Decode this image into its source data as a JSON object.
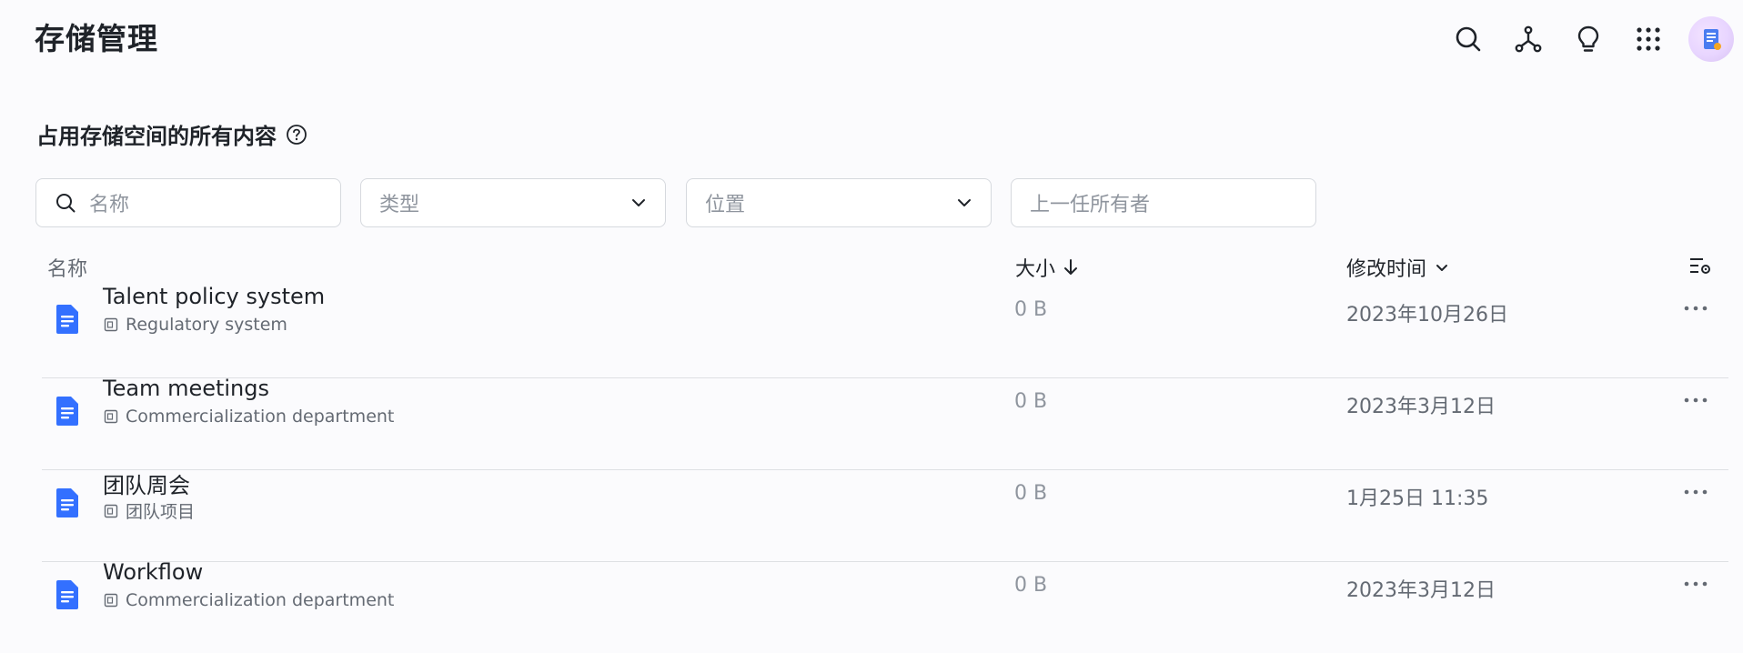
{
  "header": {
    "title": "存储管理"
  },
  "section": {
    "title": "占用存储空间的所有内容"
  },
  "filters": {
    "name_placeholder": "名称",
    "type_placeholder": "类型",
    "location_placeholder": "位置",
    "owner_placeholder": "上一任所有者"
  },
  "table": {
    "columns": {
      "name": "名称",
      "size": "大小",
      "modified": "修改时间"
    },
    "rows": [
      {
        "name": "Talent policy system",
        "location": "Regulatory system",
        "size": "0 B",
        "modified": "2023年10月26日"
      },
      {
        "name": "Team meetings",
        "location": "Commercialization department",
        "size": "0 B",
        "modified": "2023年3月12日"
      },
      {
        "name": "团队周会",
        "location": "团队项目",
        "size": "0 B",
        "modified": "1月25日 11:35"
      },
      {
        "name": "Workflow",
        "location": "Commercialization department",
        "size": "0 B",
        "modified": "2023年3月12日"
      }
    ]
  },
  "icons": {
    "top": [
      "search-icon",
      "org-graph-icon",
      "lightbulb-icon",
      "apps-grid-icon"
    ],
    "doc": "document-icon"
  },
  "colors": {
    "doc_icon": "#3370ff",
    "text": "#1f2329",
    "muted": "#646a73"
  }
}
